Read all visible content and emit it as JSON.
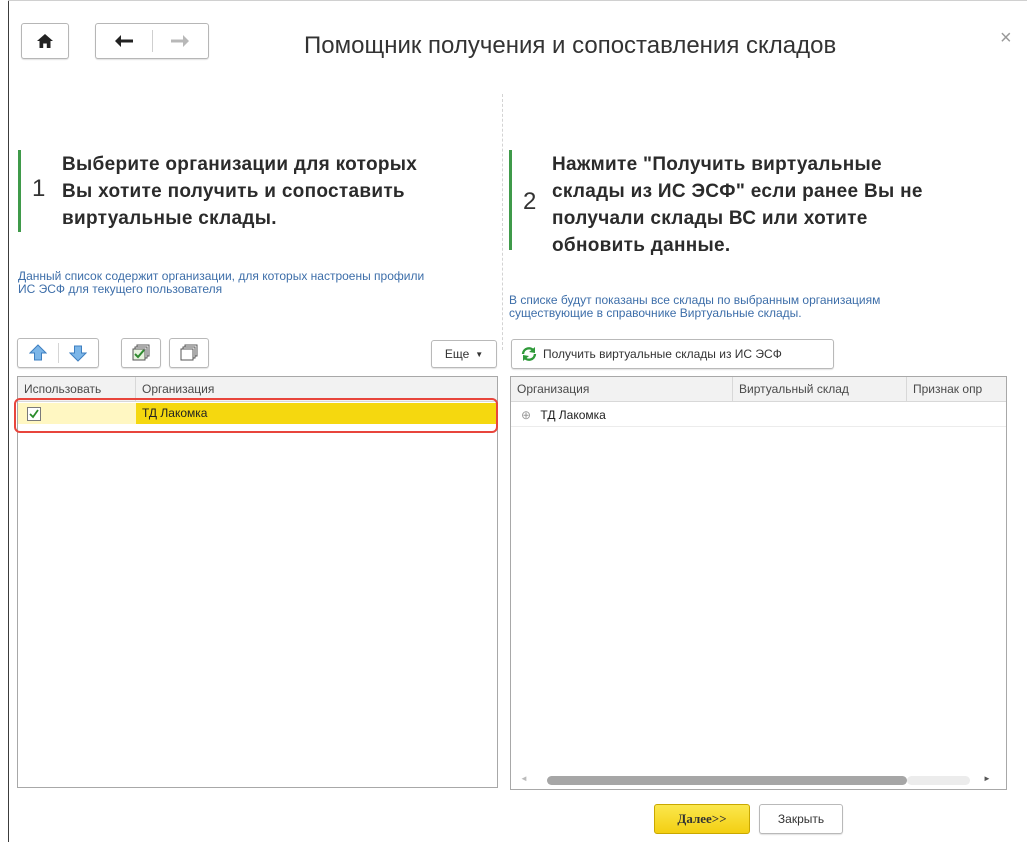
{
  "window": {
    "title": "Помощник получения и сопоставления складов",
    "close_glyph": "×"
  },
  "nav": {
    "home_icon": "home-icon",
    "back_icon": "arrow-left-icon",
    "forward_icon": "arrow-right-icon"
  },
  "left": {
    "step_number": "1",
    "step_lines": [
      "Выберите организации для которых",
      "Вы хотите получить и сопоставить",
      "виртуальные склады."
    ],
    "hint_lines": [
      "Данный список содержит организации, для которых настроены профили",
      "ИС ЭСФ для текущего пользователя"
    ],
    "toolbar": {
      "more_label": "Еще"
    },
    "grid": {
      "columns": [
        "Использовать",
        "Организация"
      ],
      "rows": [
        {
          "use": true,
          "organization": "ТД Лакомка"
        }
      ]
    }
  },
  "right": {
    "step_number": "2",
    "step_lines": [
      "Нажмите \"Получить виртуальные",
      "склады из ИС ЭСФ\" если ранее Вы не",
      "получали склады ВС или хотите",
      "обновить данные."
    ],
    "hint_lines": [
      "В списке будут показаны все склады по выбранным организациям",
      "существующие в справочнике Виртуальные склады."
    ],
    "toolbar": {
      "fetch_label": "Получить виртуальные склады из ИС ЭСФ"
    },
    "grid": {
      "columns": [
        "Организация",
        "Виртуальный склад",
        "Признак опр"
      ],
      "rows": [
        {
          "organization": "ТД Лакомка"
        }
      ]
    }
  },
  "footer": {
    "next_label": "Далее>>",
    "close_label": "Закрыть"
  },
  "colors": {
    "accent_bar": "#3f9a4a",
    "row_highlight": "#f5d80f",
    "hint_text": "#3d6ea9",
    "callout_border": "#e8453c"
  }
}
